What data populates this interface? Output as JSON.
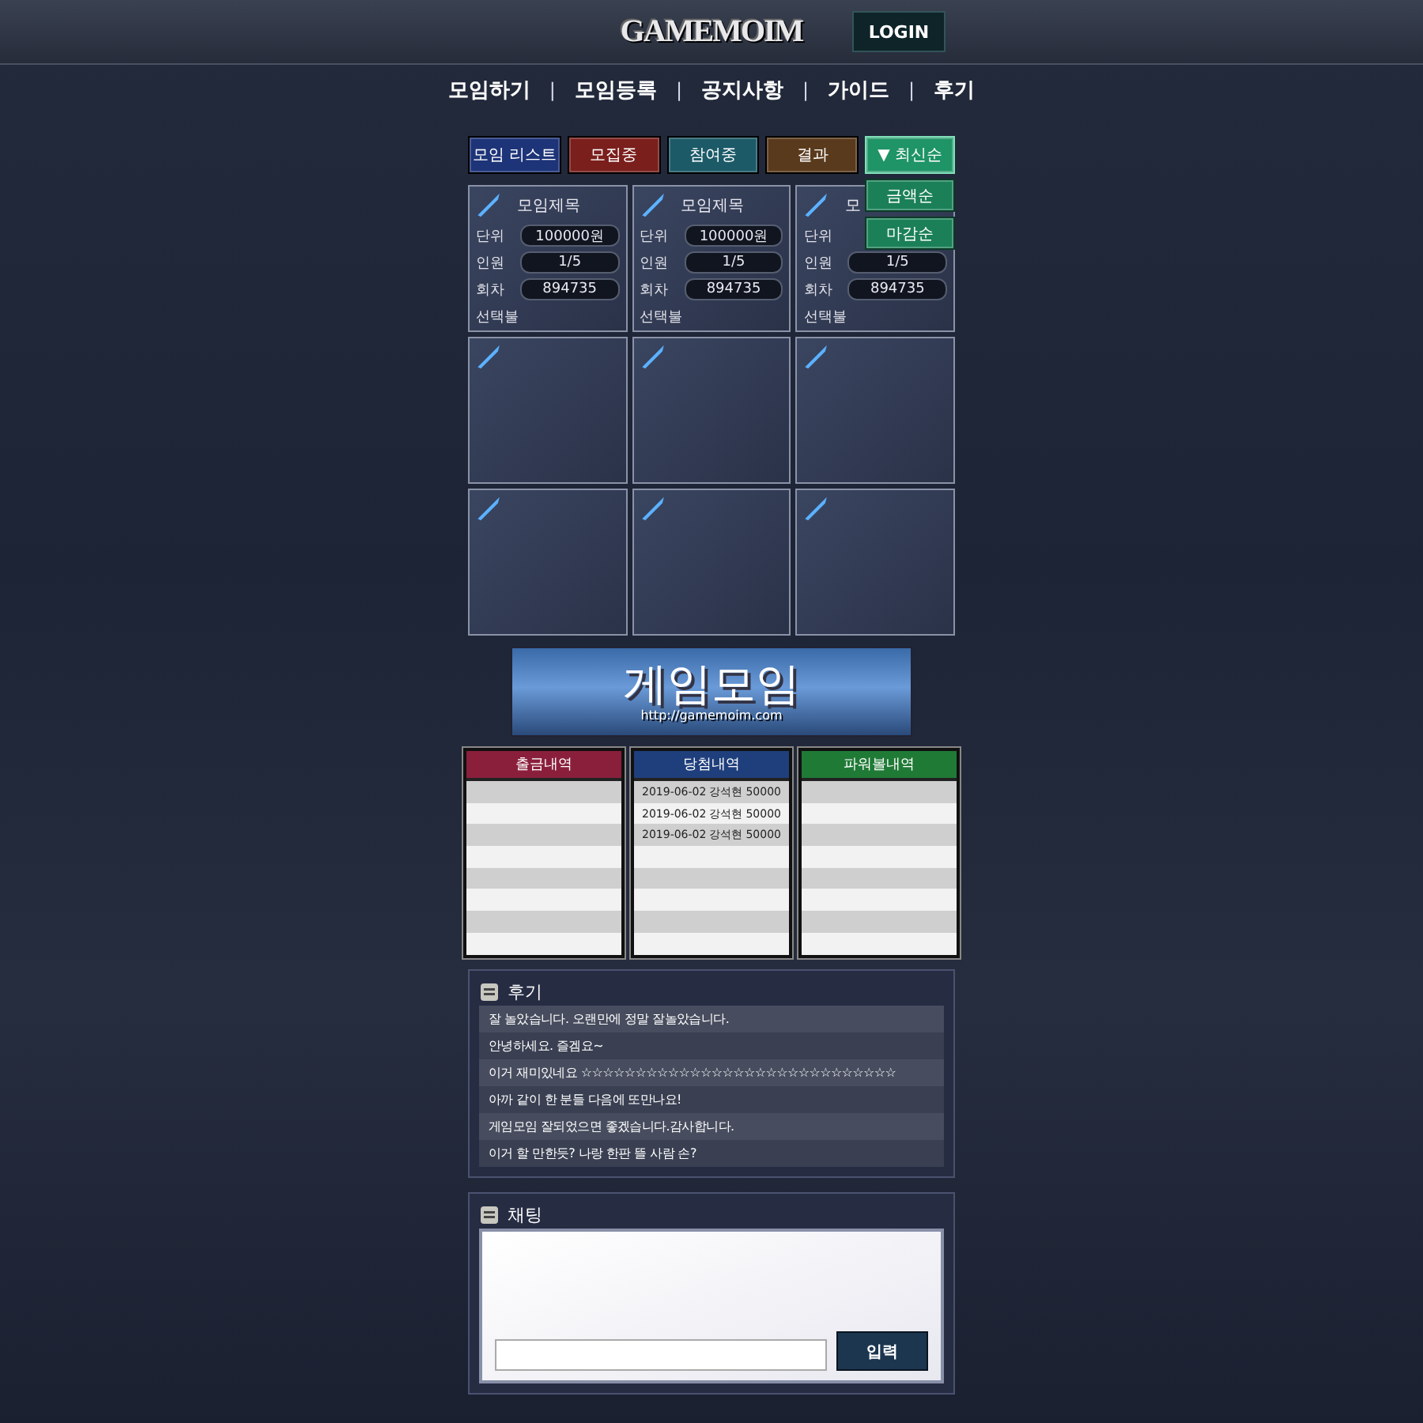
{
  "header": {
    "logo": "GAMEMOIM",
    "login": "LOGIN"
  },
  "nav": [
    {
      "kind": "link",
      "label": "모임하기"
    },
    {
      "kind": "separator",
      "label": "|"
    },
    {
      "kind": "link",
      "label": "모임등록"
    },
    {
      "kind": "separator",
      "label": "|"
    },
    {
      "kind": "link",
      "label": "공지사항"
    },
    {
      "kind": "separator",
      "label": "|"
    },
    {
      "kind": "link",
      "label": "가이드"
    },
    {
      "kind": "separator",
      "label": "|"
    },
    {
      "kind": "link",
      "label": "후기"
    }
  ],
  "filters": [
    {
      "label": "모임 리스트",
      "color": "#1d3478"
    },
    {
      "label": "모집중",
      "color": "#7a1f1c"
    },
    {
      "label": "참여중",
      "color": "#1c5a68"
    },
    {
      "label": "결과",
      "color": "#5a3a1c"
    }
  ],
  "sort": {
    "arrow": "▼",
    "label": "최신순",
    "expanded": true,
    "options": [
      "금액순",
      "마감순"
    ]
  },
  "cards": [
    {
      "kind": "filled",
      "title": "모임제목",
      "fields": [
        {
          "label": "단위",
          "value": "100000원"
        },
        {
          "label": "인원",
          "value": "1/5"
        },
        {
          "label": "회차",
          "value": "894735"
        }
      ],
      "note": "선택불"
    },
    {
      "kind": "filled",
      "title": "모임제목",
      "fields": [
        {
          "label": "단위",
          "value": "100000원"
        },
        {
          "label": "인원",
          "value": "1/5"
        },
        {
          "label": "회차",
          "value": "894735"
        }
      ],
      "note": "선택불"
    },
    {
      "kind": "filled",
      "title": "모",
      "fields": [
        {
          "label": "단위"
        },
        {
          "label": "인원",
          "value": "1/5"
        },
        {
          "label": "회차",
          "value": "894735"
        }
      ],
      "note": "선택불"
    },
    {
      "kind": "empty"
    },
    {
      "kind": "empty"
    },
    {
      "kind": "empty"
    },
    {
      "kind": "empty"
    },
    {
      "kind": "empty"
    },
    {
      "kind": "empty"
    }
  ],
  "banner": {
    "title": "게임모임",
    "url": "http://gamemoim.com"
  },
  "lists": [
    {
      "title": "출금내역",
      "color": "#8a1f3c"
    },
    {
      "title": "당첨내역",
      "color": "#1f3f7c",
      "rows": [
        {
          "date": "2019-06-02",
          "name": "강석현",
          "amount": "50000"
        },
        {
          "date": "2019-06-02",
          "name": "강석현",
          "amount": "50000"
        },
        {
          "date": "2019-06-02",
          "name": "강석현",
          "amount": "50000"
        }
      ]
    },
    {
      "title": "파워볼내역",
      "color": "#1f7a36"
    }
  ],
  "reviews": {
    "title": "후기",
    "items": [
      "잘 놀았습니다. 오랜만에 정말 잘놀았습니다.",
      "안녕하세요. 즐겜요~",
      "이거 재미있네요 ☆☆☆☆☆☆☆☆☆☆☆☆☆☆☆☆☆☆☆☆☆☆☆☆☆☆☆☆☆",
      "아까 같이 한 분들 다음에 또만나요!",
      "게임모임 잘되었으면 좋겠습니다.감사합니다.",
      "이거 할 만한듯? 나랑 한판 뜰 사람 손?"
    ]
  },
  "chat": {
    "title": "채팅",
    "button": "입력"
  }
}
